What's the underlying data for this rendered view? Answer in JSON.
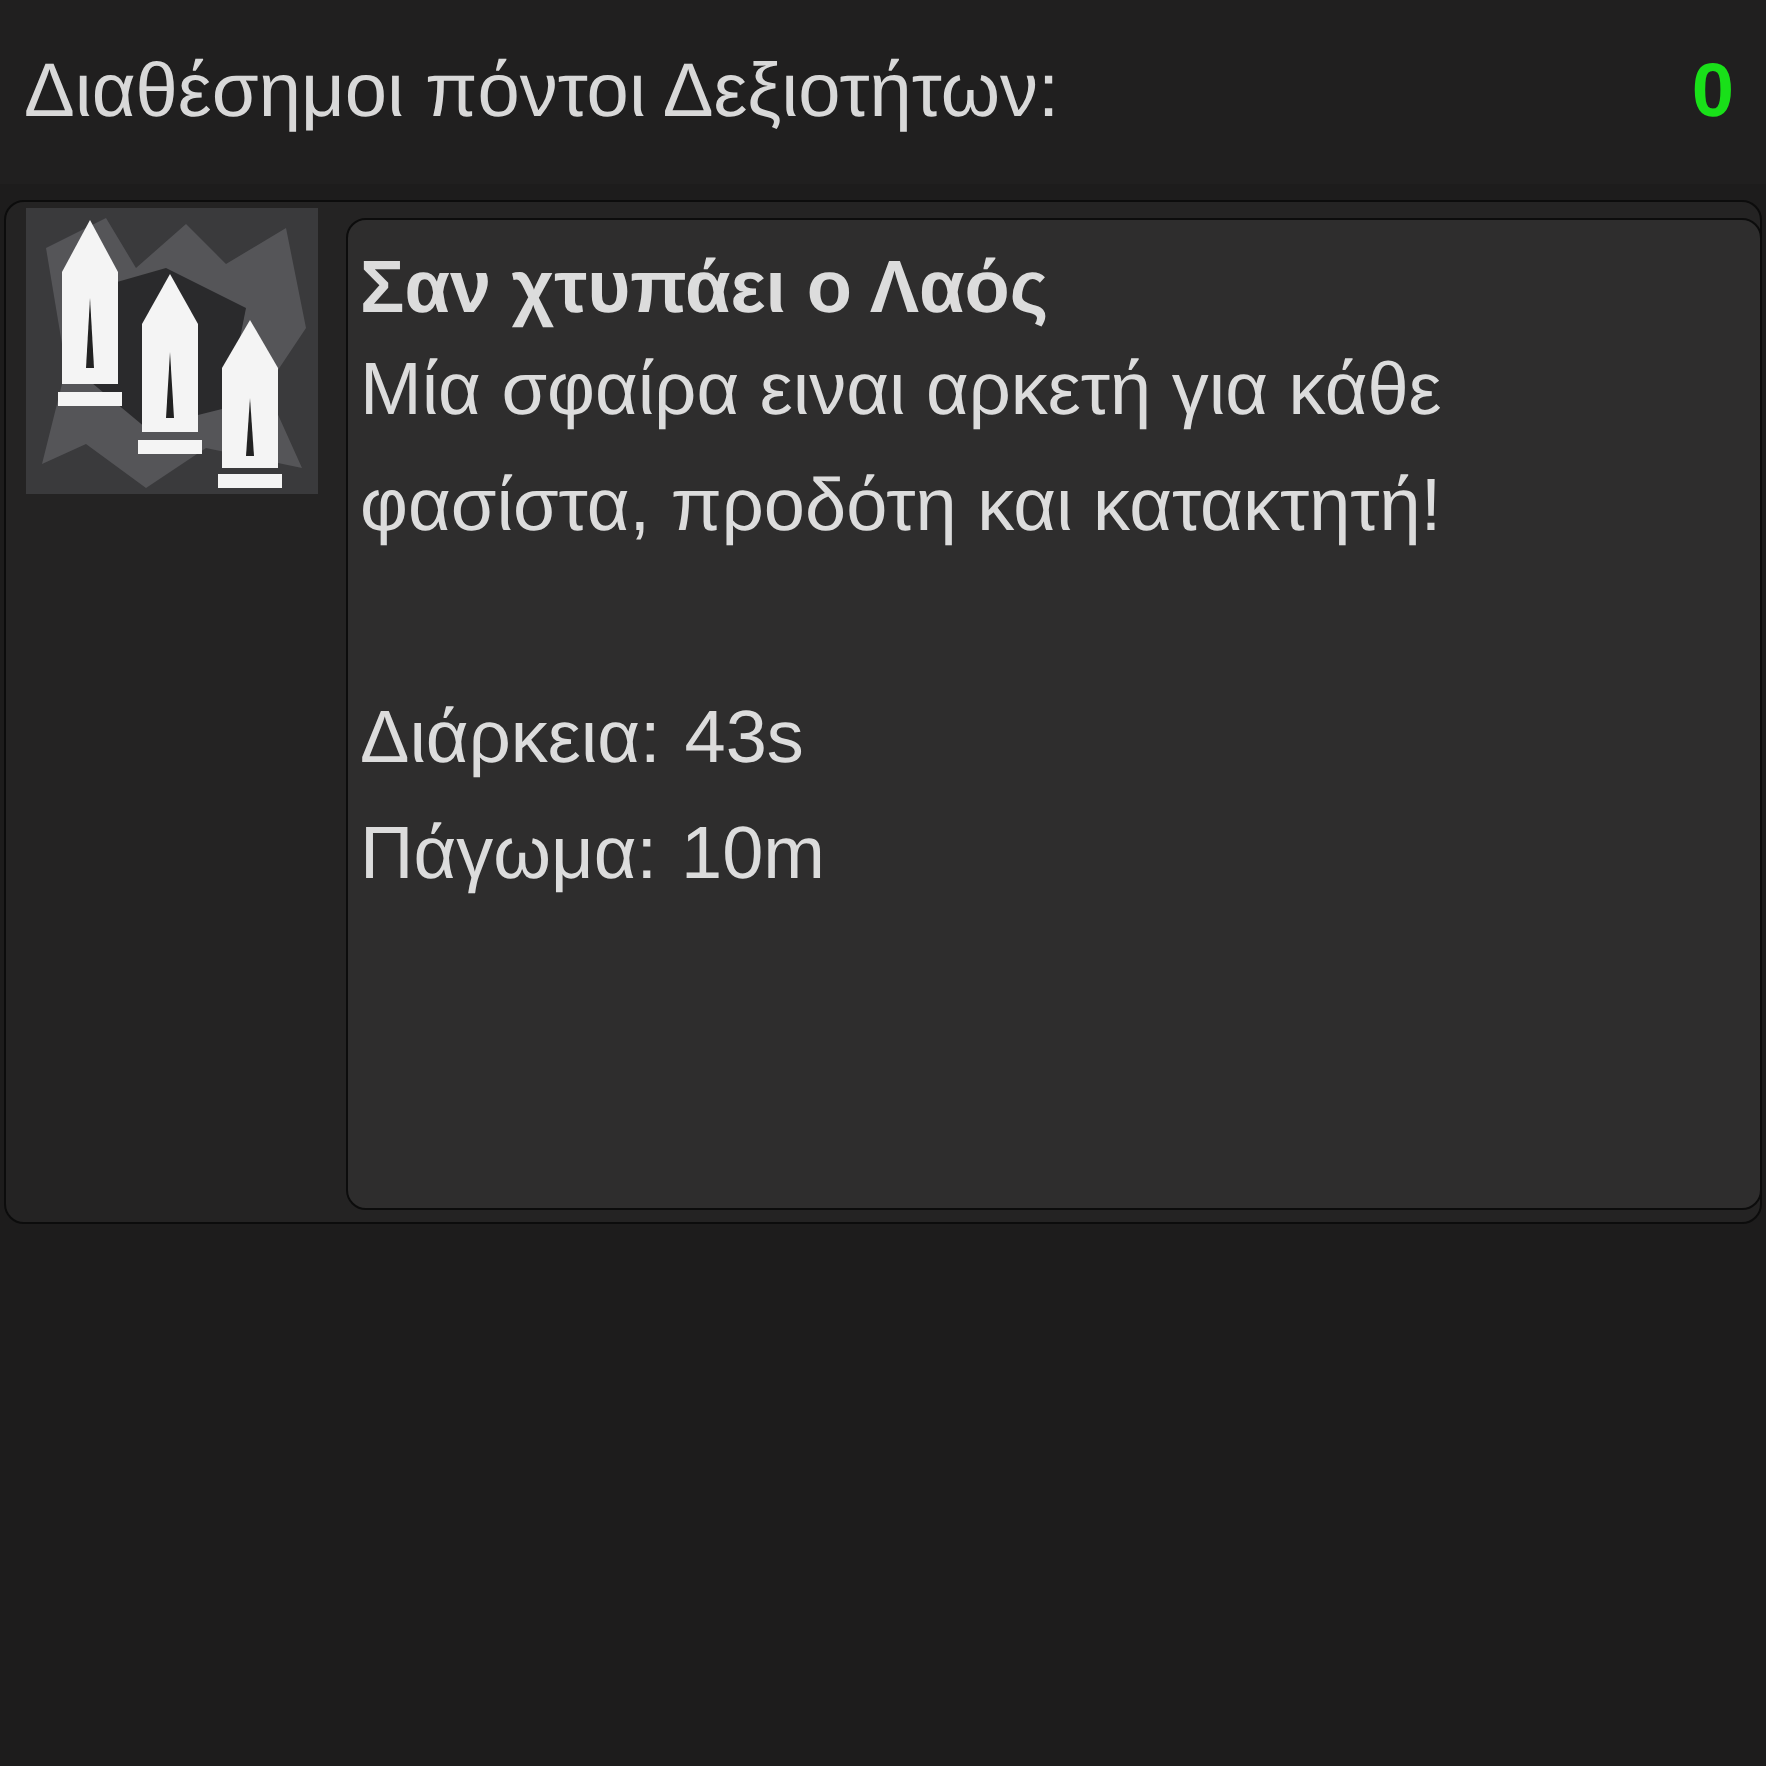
{
  "header": {
    "label": "Διαθέσημοι πόντοι Δεξιοτήτων:",
    "points": "0"
  },
  "skill": {
    "title": "Σαν χτυπάει ο Λαός",
    "description": "Μία σφαίρα ειναι αρκετή για κάθε φασίστα, προδότη και κατακτητή!",
    "stats": [
      {
        "label": "Διάρκεια:",
        "value": "43s"
      },
      {
        "label": "Πάγωμα:",
        "value": "10m"
      }
    ]
  }
}
